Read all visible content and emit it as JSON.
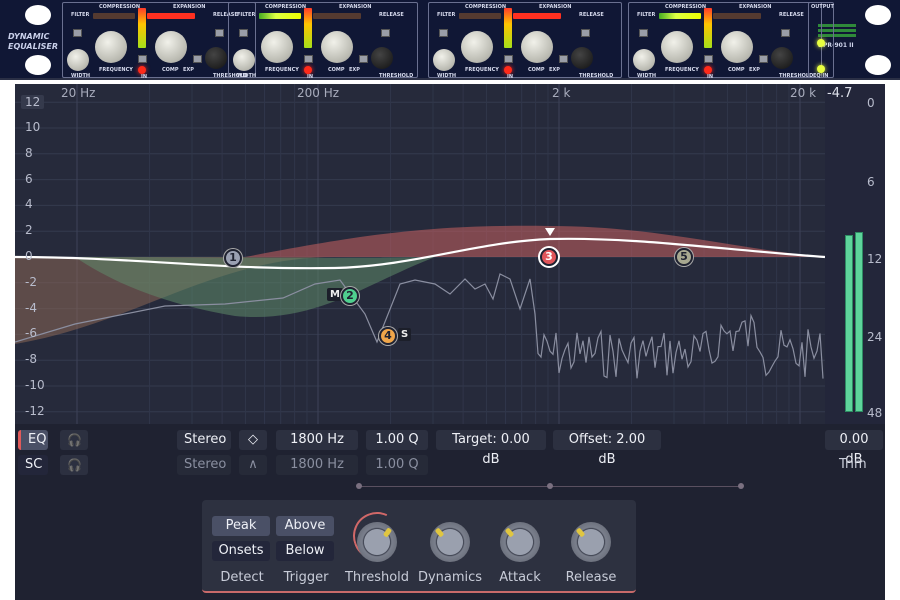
{
  "rack": {
    "brand_line1": "DYNAMIC",
    "brand_line2": "EQUALISER",
    "model": "DPR-901 II",
    "section_labels": {
      "compression": "COMPRESSION",
      "expansion": "EXPANSION",
      "filter": "FILTER",
      "release": "RELEASE",
      "frequency": "FREQUENCY",
      "width": "WIDTH",
      "comp": "COMP",
      "exp": "EXP",
      "threshold": "THRESHOLD",
      "in": "IN",
      "output": "OUTPUT",
      "eq_in": "EQ IN"
    }
  },
  "graph": {
    "freq_labels": [
      "20 Hz",
      "200 Hz",
      "2 k",
      "20 k"
    ],
    "db_top": "12",
    "db_labels": [
      "10",
      "8",
      "6",
      "4",
      "2",
      "0",
      "-2",
      "-4",
      "-6",
      "-8",
      "-10",
      "-12"
    ],
    "bands": [
      {
        "id": "1",
        "color": "#9aa0b2"
      },
      {
        "id": "2",
        "color": "#4fcf8e",
        "tag": "M"
      },
      {
        "id": "3",
        "color": "#e0555a"
      },
      {
        "id": "4",
        "color": "#f0a64a",
        "tag": "S"
      },
      {
        "id": "5",
        "color": "#a8a890"
      }
    ]
  },
  "meter": {
    "peak": "-4.7",
    "scale": [
      "0",
      "6",
      "12",
      "24",
      "48"
    ],
    "level_left": 0.56,
    "level_right": 0.57,
    "trim_value": "0.00 dB",
    "trim_label": "Trim"
  },
  "band_row": {
    "eq": "EQ",
    "sc": "SC",
    "channel": "Stereo",
    "freq": "1800 Hz",
    "q": "1.00 Q",
    "target": "Target: 0.00 dB",
    "offset": "Offset: 2.00 dB"
  },
  "sc_row": {
    "channel": "Stereo",
    "freq": "1800 Hz",
    "q": "1.00 Q"
  },
  "dynamics": {
    "detect_options": [
      "Peak",
      "Onsets"
    ],
    "detect_selected": "Peak",
    "detect_label": "Detect",
    "trigger_options": [
      "Above",
      "Below"
    ],
    "trigger_selected": "Above",
    "trigger_label": "Trigger",
    "knobs": [
      "Threshold",
      "Dynamics",
      "Attack",
      "Release"
    ]
  },
  "colors": {
    "accent": "#e0555a",
    "meter": "#5ed49b"
  }
}
